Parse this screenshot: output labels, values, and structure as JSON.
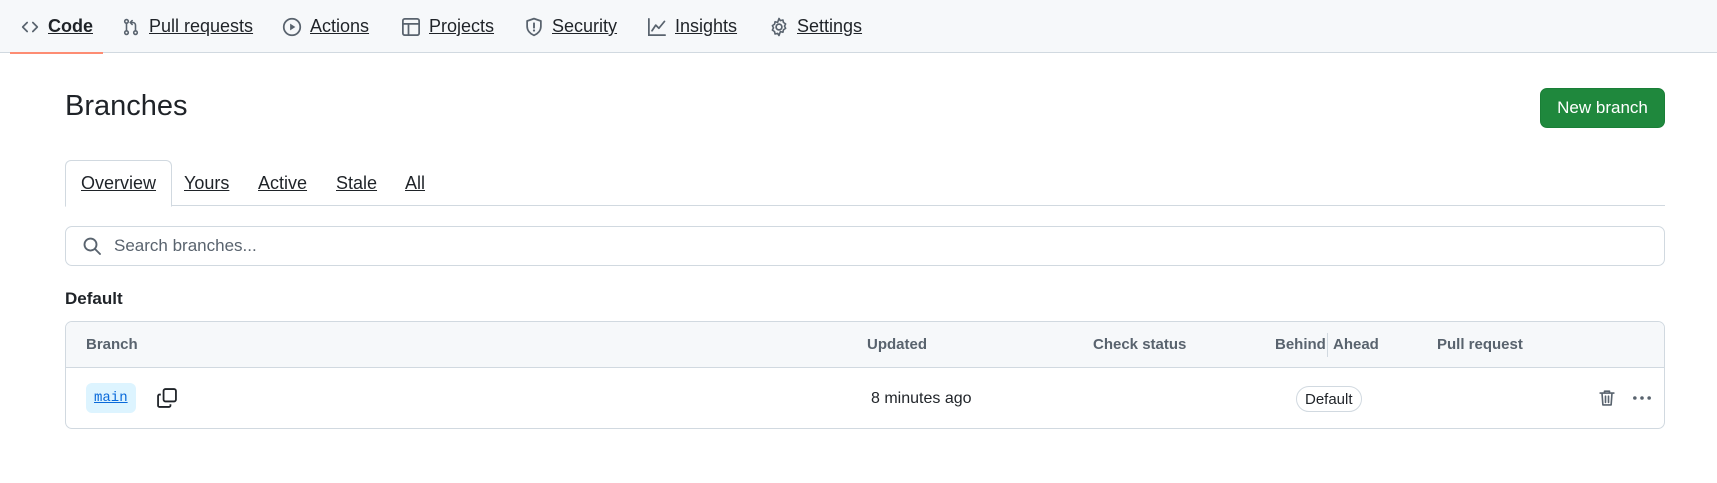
{
  "nav": {
    "items": [
      {
        "label": "Code",
        "icon": "code-icon",
        "selected": true
      },
      {
        "label": "Pull requests",
        "icon": "git-pull-request-icon"
      },
      {
        "label": "Actions",
        "icon": "play-icon"
      },
      {
        "label": "Projects",
        "icon": "table-icon"
      },
      {
        "label": "Security",
        "icon": "shield-icon"
      },
      {
        "label": "Insights",
        "icon": "graph-icon"
      },
      {
        "label": "Settings",
        "icon": "gear-icon"
      }
    ]
  },
  "page": {
    "title": "Branches",
    "new_branch_label": "New branch"
  },
  "tabs": [
    {
      "label": "Overview",
      "selected": true
    },
    {
      "label": "Yours"
    },
    {
      "label": "Active"
    },
    {
      "label": "Stale"
    },
    {
      "label": "All"
    }
  ],
  "search": {
    "placeholder": "Search branches..."
  },
  "default_section": {
    "title": "Default",
    "columns": {
      "branch": "Branch",
      "updated": "Updated",
      "check_status": "Check status",
      "behind": "Behind",
      "ahead": "Ahead",
      "pull_request": "Pull request"
    },
    "rows": [
      {
        "branch": "main",
        "updated": "8 minutes ago",
        "badge": "Default"
      }
    ]
  },
  "colors": {
    "accent_underline": "#fd8c73",
    "primary_button": "#1f883d",
    "branch_pill_bg": "#ddf4ff",
    "link": "#0969da"
  }
}
